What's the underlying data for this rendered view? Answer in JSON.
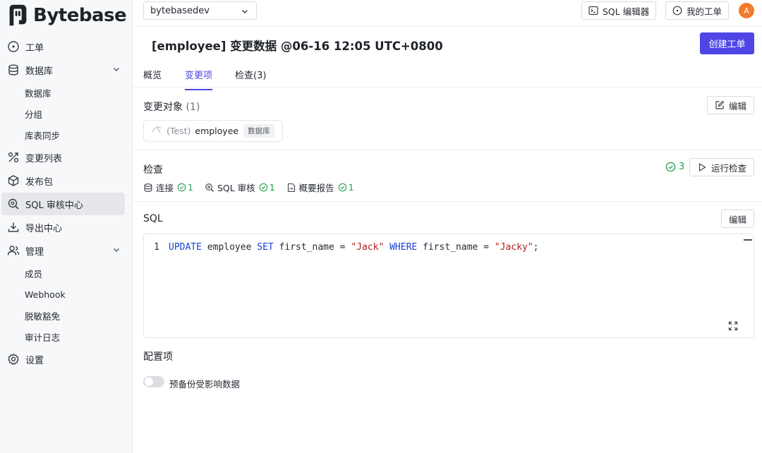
{
  "app": {
    "brand": "Bytebase"
  },
  "sidebar": {
    "items": [
      {
        "label": "工单",
        "icon": "circle-dot-icon"
      },
      {
        "label": "数据库",
        "icon": "database-icon",
        "expandable": true,
        "children": [
          "数据库",
          "分组",
          "库表同步"
        ]
      },
      {
        "label": "变更列表",
        "icon": "changes-icon"
      },
      {
        "label": "发布包",
        "icon": "package-icon"
      },
      {
        "label": "SQL 审核中心",
        "icon": "search-review-icon",
        "active": true
      },
      {
        "label": "导出中心",
        "icon": "download-icon"
      },
      {
        "label": "管理",
        "icon": "users-icon",
        "expandable": true,
        "children": [
          "成员",
          "Webhook",
          "脱敏豁免",
          "审计日志"
        ]
      },
      {
        "label": "设置",
        "icon": "gear-icon"
      }
    ]
  },
  "header": {
    "project": "bytebasedev",
    "sql_editor": "SQL 编辑器",
    "my_issues": "我的工单",
    "avatar_initial": "A"
  },
  "page": {
    "title": "[employee] 变更数据 @06-16 12:05 UTC+0800",
    "create_button": "创建工单",
    "tabs": [
      {
        "label": "概览"
      },
      {
        "label": "变更项",
        "active": true
      },
      {
        "label": "检查(3)"
      }
    ]
  },
  "targets": {
    "label": "变更对象",
    "count": "(1)",
    "edit": "编辑",
    "database": {
      "env": "(Test)",
      "name": "employee",
      "tag": "数据库"
    }
  },
  "checks": {
    "label": "检查",
    "total": "3",
    "run_button": "运行检查",
    "items": [
      {
        "label": "连接",
        "count": "1",
        "icon": "database-icon"
      },
      {
        "label": "SQL 审核",
        "count": "1",
        "icon": "search-review-icon"
      },
      {
        "label": "概要报告",
        "count": "1",
        "icon": "report-icon"
      }
    ]
  },
  "sql": {
    "label": "SQL",
    "edit": "编辑",
    "line_number": "1",
    "tokens": [
      {
        "t": "kw",
        "v": "UPDATE"
      },
      {
        "t": "plain",
        "v": " employee "
      },
      {
        "t": "kw",
        "v": "SET"
      },
      {
        "t": "plain",
        "v": " first_name = "
      },
      {
        "t": "str",
        "v": "\"Jack\""
      },
      {
        "t": "plain",
        "v": " "
      },
      {
        "t": "kw",
        "v": "WHERE"
      },
      {
        "t": "plain",
        "v": " first_name = "
      },
      {
        "t": "str",
        "v": "\"Jacky\""
      },
      {
        "t": "plain",
        "v": ";"
      }
    ]
  },
  "options": {
    "label": "配置项",
    "backup_toggle": {
      "label": "预备份受影响数据",
      "on": false
    }
  },
  "colors": {
    "accent": "#4f46e5",
    "success": "#22a04b",
    "avatar": "#f27b2a"
  }
}
